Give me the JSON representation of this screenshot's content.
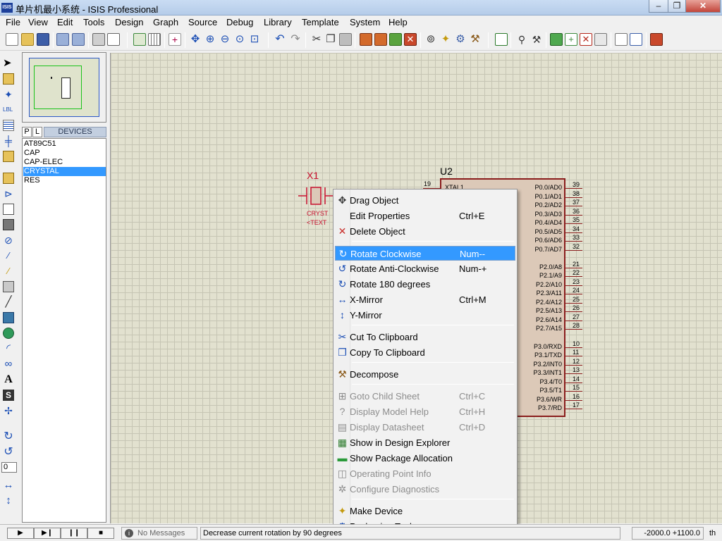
{
  "window": {
    "title": "单片机最小系统 - ISIS Professional",
    "icon_text": "ISIS",
    "minimize": "–",
    "restore": "❐",
    "close": "✕"
  },
  "menubar": [
    "File",
    "View",
    "Edit",
    "Tools",
    "Design",
    "Graph",
    "Source",
    "Debug",
    "Library",
    "Template",
    "System",
    "Help"
  ],
  "devices": {
    "tab_p": "P",
    "tab_l": "L",
    "header": "DEVICES",
    "items": [
      "AT89C51",
      "CAP",
      "CAP-ELEC",
      "CRYSTAL",
      "RES"
    ],
    "selected": "CRYSTAL"
  },
  "crystal": {
    "ref": "X1",
    "value": "CRYST",
    "text": "<TEXT"
  },
  "chip": {
    "ref": "U2",
    "left_pin_num": "19",
    "left_pin_name": "XTAL1",
    "right_pins": [
      {
        "name": "P0.0/AD0",
        "num": "39"
      },
      {
        "name": "P0.1/AD1",
        "num": "38"
      },
      {
        "name": "P0.2/AD2",
        "num": "37"
      },
      {
        "name": "P0.3/AD3",
        "num": "36"
      },
      {
        "name": "P0.4/AD4",
        "num": "35"
      },
      {
        "name": "P0.5/AD5",
        "num": "34"
      },
      {
        "name": "P0.6/AD6",
        "num": "33"
      },
      {
        "name": "P0.7/AD7",
        "num": "32"
      },
      {
        "name": "P2.0/A8",
        "num": "21"
      },
      {
        "name": "P2.1/A9",
        "num": "22"
      },
      {
        "name": "P2.2/A10",
        "num": "23"
      },
      {
        "name": "P2.3/A11",
        "num": "24"
      },
      {
        "name": "P2.4/A12",
        "num": "25"
      },
      {
        "name": "P2.5/A13",
        "num": "26"
      },
      {
        "name": "P2.6/A14",
        "num": "27"
      },
      {
        "name": "P2.7/A15",
        "num": "28"
      },
      {
        "name": "P3.0/RXD",
        "num": "10"
      },
      {
        "name": "P3.1/TXD",
        "num": "11"
      },
      {
        "name": "P3.2/INT0",
        "num": "12"
      },
      {
        "name": "P3.3/INT1",
        "num": "13"
      },
      {
        "name": "P3.4/T0",
        "num": "14"
      },
      {
        "name": "P3.5/T1",
        "num": "15"
      },
      {
        "name": "P3.6/WR",
        "num": "16"
      },
      {
        "name": "P3.7/RD",
        "num": "17"
      }
    ]
  },
  "context_menu": {
    "items": [
      {
        "label": "Drag Object",
        "shortcut": "",
        "icon": "✥",
        "state": "normal"
      },
      {
        "label": "Edit Properties",
        "shortcut": "Ctrl+E",
        "icon": "",
        "state": "normal"
      },
      {
        "label": "Delete Object",
        "shortcut": "",
        "icon": "✕",
        "state": "normal"
      },
      {
        "label": "Rotate Clockwise",
        "shortcut": "Num--",
        "icon": "↻",
        "state": "highlighted"
      },
      {
        "label": "Rotate Anti-Clockwise",
        "shortcut": "Num-+",
        "icon": "↺",
        "state": "normal"
      },
      {
        "label": "Rotate 180 degrees",
        "shortcut": "",
        "icon": "↻",
        "state": "normal"
      },
      {
        "label": "X-Mirror",
        "shortcut": "Ctrl+M",
        "icon": "↔",
        "state": "normal"
      },
      {
        "label": "Y-Mirror",
        "shortcut": "",
        "icon": "↕",
        "state": "normal"
      },
      {
        "label": "Cut To Clipboard",
        "shortcut": "",
        "icon": "✂",
        "state": "normal"
      },
      {
        "label": "Copy To Clipboard",
        "shortcut": "",
        "icon": "❐",
        "state": "normal"
      },
      {
        "label": "Decompose",
        "shortcut": "",
        "icon": "⚒",
        "state": "normal"
      },
      {
        "label": "Goto Child Sheet",
        "shortcut": "Ctrl+C",
        "icon": "⊞",
        "state": "disabled"
      },
      {
        "label": "Display Model Help",
        "shortcut": "Ctrl+H",
        "icon": "?",
        "state": "disabled"
      },
      {
        "label": "Display Datasheet",
        "shortcut": "Ctrl+D",
        "icon": "▤",
        "state": "disabled"
      },
      {
        "label": "Show in Design Explorer",
        "shortcut": "",
        "icon": "▦",
        "state": "normal"
      },
      {
        "label": "Show Package Allocation",
        "shortcut": "",
        "icon": "▬",
        "state": "normal"
      },
      {
        "label": "Operating Point Info",
        "shortcut": "",
        "icon": "◫",
        "state": "disabled"
      },
      {
        "label": "Configure Diagnostics",
        "shortcut": "",
        "icon": "✲",
        "state": "disabled"
      },
      {
        "label": "Make Device",
        "shortcut": "",
        "icon": "✦",
        "state": "normal"
      },
      {
        "label": "Packaging Tool",
        "shortcut": "",
        "icon": "⚙",
        "state": "normal"
      }
    ]
  },
  "rotation_value": "0",
  "status": {
    "messages": "No Messages",
    "hint": "Decrease current rotation by 90 degrees",
    "coords": "-2000.0  +1100.0",
    "units": "th"
  },
  "colors": {
    "canvas": "#e2e1cf",
    "schematic": "#c8102e",
    "chip_fill": "#dcc9b8",
    "highlight": "#3399ff"
  }
}
